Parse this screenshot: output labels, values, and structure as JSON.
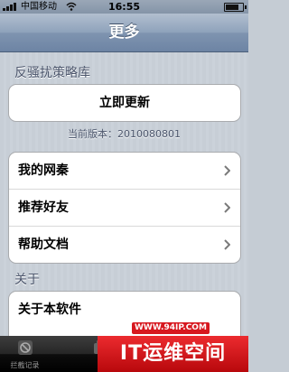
{
  "status_bar": {
    "carrier": "中国移动",
    "time": "16:55",
    "battery_level": 0.85
  },
  "nav": {
    "title": "更多"
  },
  "update_section": {
    "title": "反骚扰策略库",
    "button_label": "立即更新",
    "version_text": "当前版本：2010080801"
  },
  "menu": [
    {
      "label": "我的网秦"
    },
    {
      "label": "推荐好友"
    },
    {
      "label": "帮助文档"
    }
  ],
  "about_section": {
    "title": "关于",
    "items": [
      {
        "label": "关于本软件"
      }
    ]
  },
  "tabbar": {
    "tabs": [
      {
        "label": "拦截记录",
        "icon": "block-icon"
      }
    ]
  },
  "watermark": {
    "url": "WWW.94IP.COM",
    "text": "IT运维空间"
  },
  "colors": {
    "nav": "#7f94b0",
    "background": "#c5ccd4",
    "section_text": "#4c566c",
    "watermark": "#d7181f"
  }
}
